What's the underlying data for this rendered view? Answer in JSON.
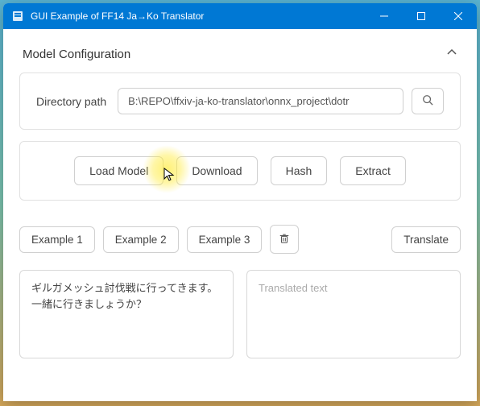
{
  "window": {
    "title": "GUI Example of FF14 Ja→Ko Translator"
  },
  "config": {
    "section_title": "Model Configuration",
    "dir_label": "Directory path",
    "dir_value": "B:\\REPO\\ffxiv-ja-ko-translator\\onnx_project\\dotr"
  },
  "actions": {
    "load": "Load Model",
    "download": "Download",
    "hash": "Hash",
    "extract": "Extract"
  },
  "examples": {
    "e1": "Example 1",
    "e2": "Example 2",
    "e3": "Example 3",
    "translate": "Translate"
  },
  "io": {
    "source_text": "ギルガメッシュ討伐戦に行ってきます。一緒に行きましょうか？",
    "target_placeholder": "Translated text"
  }
}
